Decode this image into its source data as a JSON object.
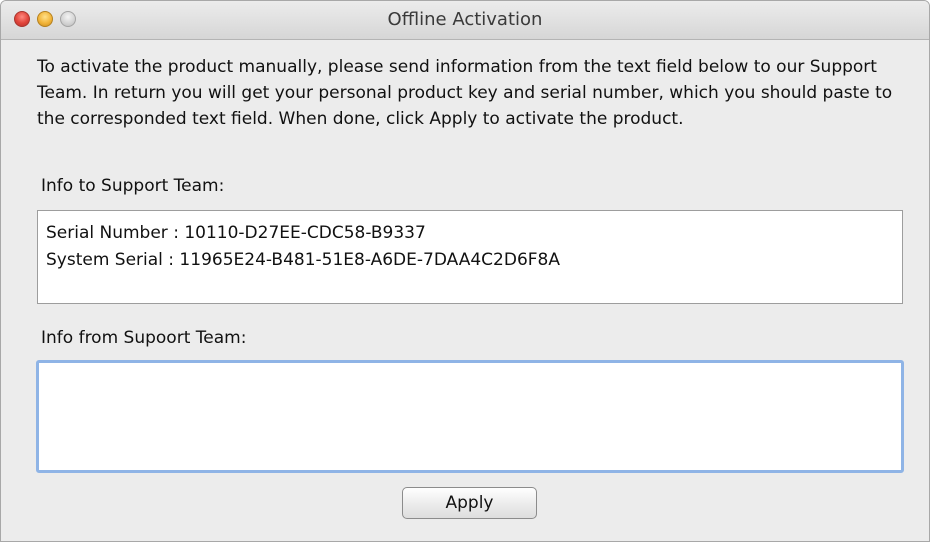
{
  "window": {
    "title": "Offline Activation"
  },
  "instructions": "To activate the product manually, please send information from the text field below to our Support Team. In return you will get your personal product key and serial number, which you should paste to the corresponded text field. When done, click Apply to activate the product.",
  "info_to": {
    "label": "Info to Support Team:",
    "lines": [
      "Serial Number : 10110-D27EE-CDC58-B9337",
      "System Serial : 11965E24-B481-51E8-A6DE-7DAA4C2D6F8A"
    ]
  },
  "info_from": {
    "label": "Info from Supoort Team:",
    "value": ""
  },
  "apply_label": "Apply"
}
